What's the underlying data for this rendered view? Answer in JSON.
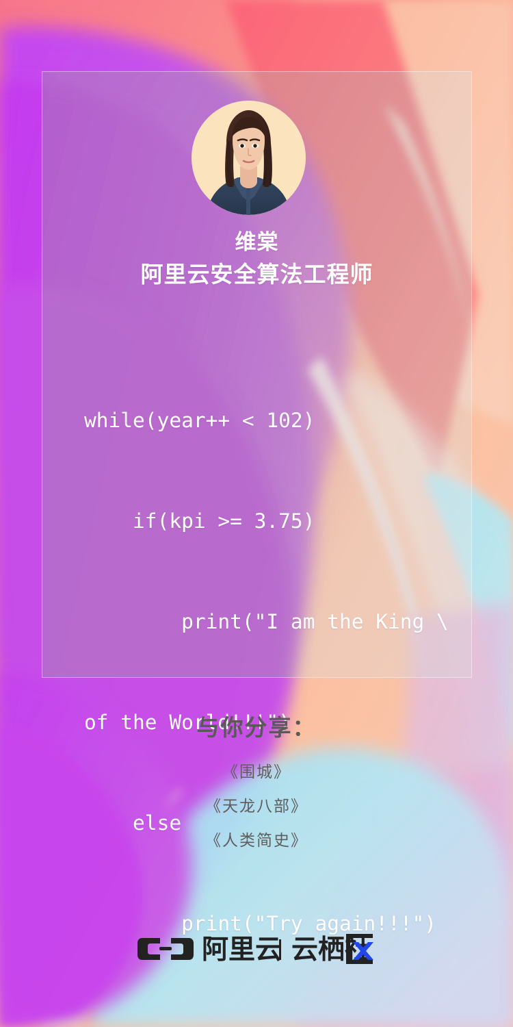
{
  "card": {
    "avatar_alt": "portrait-photo"
  },
  "identity": {
    "name": "维棠",
    "role": "阿里云安全算法工程师"
  },
  "code": {
    "lines": [
      "while(year++ < 102)",
      "    if(kpi >= 3.75)",
      "        print(\"I am the King \\",
      "of the World!!!\")",
      "    else",
      "        print(\"Try again!!!\")"
    ]
  },
  "share": {
    "heading": "与你分享：",
    "books": [
      "《围城》",
      "《天龙八部》",
      "《人类简史》"
    ]
  },
  "footer": {
    "brand": "阿里云",
    "divider": "|",
    "community": "云栖社区"
  },
  "colors": {
    "text_white": "#ffffff",
    "share_heading": "#595959",
    "book_text": "#5e5e5e",
    "logo_dark": "#222222",
    "logo_accent": "#2346ec",
    "bg_purple": "#c14ae8",
    "bg_magenta": "#d06ee0",
    "bg_coral": "#fa6d7c",
    "bg_peach": "#fcb495",
    "bg_cyan": "#9fe2f0",
    "bg_cream": "#e8e0cf",
    "avatar_bg": "#fbe3bd"
  }
}
